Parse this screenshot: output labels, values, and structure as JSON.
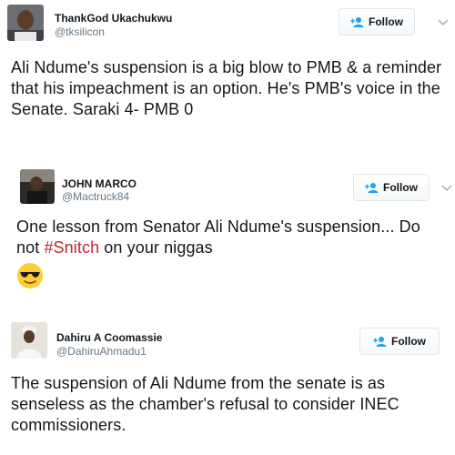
{
  "tweets": [
    {
      "name": "ThankGod Ukachukwu",
      "handle": "@tksilicon",
      "follow_label": "Follow",
      "text": "Ali Ndume's suspension is a big blow to PMB & a reminder that his impeachment is an option. He's PMB's voice in the Senate. Saraki 4- PMB 0"
    },
    {
      "name": "JOHN MARCO",
      "handle": "@Mactruck84",
      "follow_label": "Follow",
      "text_before": "One lesson from Senator Ali Ndume's suspension... Do not ",
      "hashtag": "#Snitch",
      "text_after": " on your niggas",
      "emoji": "sunglasses-emoji"
    },
    {
      "name": "Dahiru A Coomassie",
      "handle": "@DahiruAhmadu1",
      "follow_label": "Follow",
      "text": "The suspension of Ali Ndume from the senate is as senseless as the chamber's refusal to consider INEC commissioners."
    }
  ],
  "colors": {
    "hashtag": "#c0282d",
    "follow_icon": "#1da1f2",
    "handle": "#657786"
  }
}
